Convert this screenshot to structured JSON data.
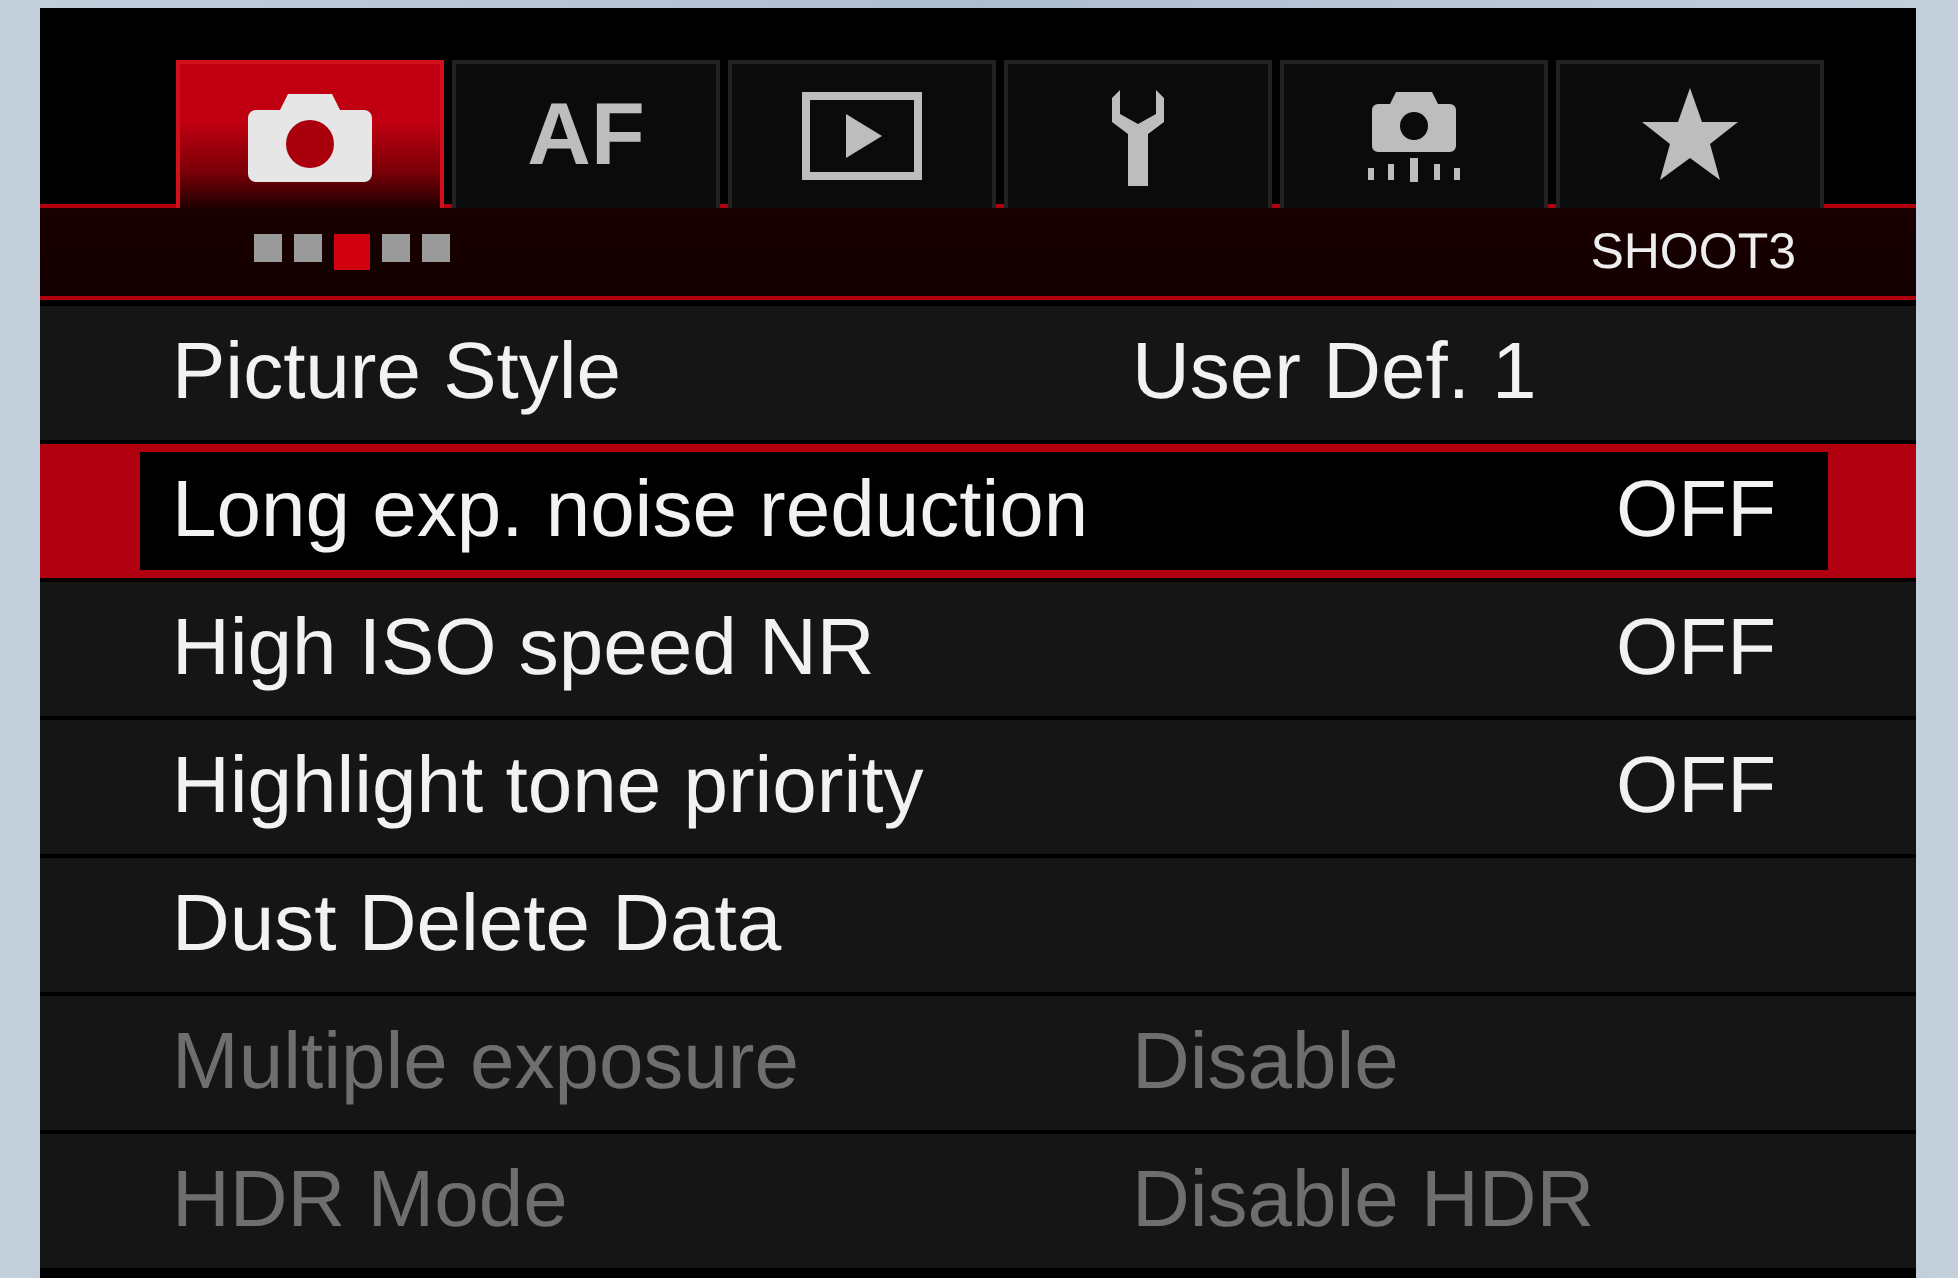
{
  "tabs": [
    {
      "selected": true
    },
    {
      "label": "AF",
      "selected": false
    },
    {
      "selected": false
    },
    {
      "selected": false
    },
    {
      "selected": false
    },
    {
      "selected": false
    }
  ],
  "pages": [
    {
      "selected": false
    },
    {
      "selected": false
    },
    {
      "selected": true
    },
    {
      "selected": false
    },
    {
      "selected": false
    }
  ],
  "page_name": "SHOOT3",
  "items": [
    {
      "label": "Picture Style",
      "value": "User Def. 1",
      "kind": "option",
      "selected": false,
      "disabled": false
    },
    {
      "label": "Long exp. noise reduction",
      "value": "OFF",
      "kind": "toggle",
      "selected": true,
      "disabled": false
    },
    {
      "label": "High ISO speed NR",
      "value": "OFF",
      "kind": "toggle",
      "selected": false,
      "disabled": false
    },
    {
      "label": "Highlight tone priority",
      "value": "OFF",
      "kind": "toggle",
      "selected": false,
      "disabled": false
    },
    {
      "label": "Dust Delete Data",
      "selected": false,
      "disabled": false
    },
    {
      "label": "Multiple exposure",
      "value": "Disable",
      "kind": "option",
      "selected": false,
      "disabled": true
    },
    {
      "label": "HDR Mode",
      "value": "Disable HDR",
      "kind": "option",
      "selected": false,
      "disabled": true
    }
  ]
}
